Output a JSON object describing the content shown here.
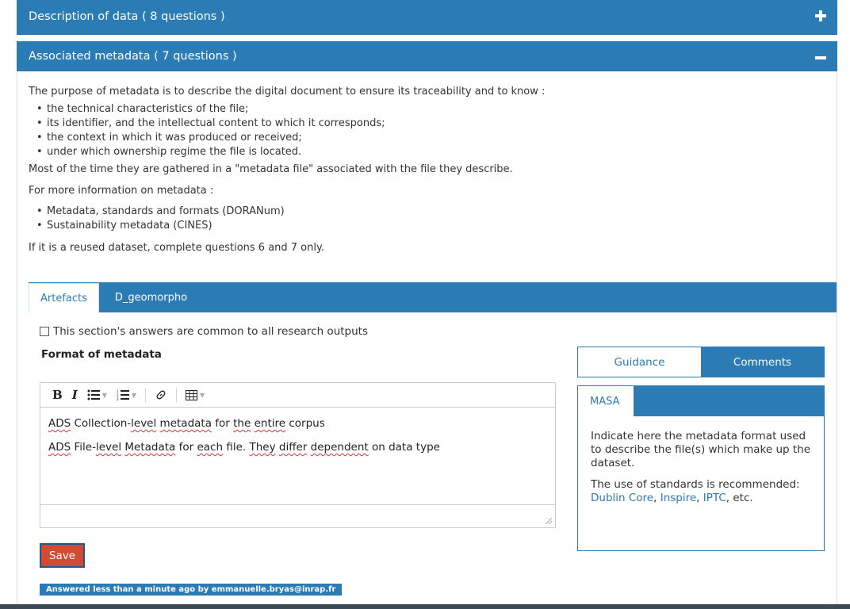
{
  "panels": {
    "description": {
      "title": "Description of data ( 8 questions )",
      "toggle": "+"
    },
    "metadata": {
      "title": "Associated metadata ( 7 questions )",
      "toggle": "−"
    }
  },
  "intro": {
    "p1": "The purpose of metadata is to describe the digital document to ensure its traceability and to know :",
    "list1": [
      "the technical characteristics of the file;",
      "its identifier, and the intellectual content to which it corresponds;",
      "the context in which it was produced or received;",
      "under which ownership regime the file is located."
    ],
    "p2": "Most of the time they are gathered in a \"metadata file\" associated with the file they describe.",
    "p3": "For more information on metadata :",
    "list2": [
      "Metadata, standards and formats (DORANum)",
      "Sustainability metadata (CINES)"
    ],
    "p4": "If it is a reused dataset, complete questions 6 and 7 only."
  },
  "tabs": {
    "active": "Artefacts",
    "second": "D_geomorpho"
  },
  "common_checkbox": "This section's answers are common to all research outputs",
  "question": {
    "title": "Format of metadata"
  },
  "editor": {
    "toolbar": {
      "bold": "B",
      "italic": "I"
    },
    "line1": {
      "a": "ADS",
      "b": " Collection-",
      "c": "level",
      "d": " ",
      "e": "metadata",
      "f": " for ",
      "g": "the",
      "h": " ",
      "i": "entire",
      "j": " corpus"
    },
    "line2": {
      "a": "ADS",
      "b": " File-",
      "c": "level",
      "d": " ",
      "e": "Metadata",
      "f": " for ",
      "g": "each",
      "h": " file. ",
      "i": "They",
      "j": " ",
      "k": "differ",
      "l": " ",
      "m": "dependent",
      "n": " on data type"
    }
  },
  "save_button": "Save",
  "answered_text": "Answered less than a minute ago by emmanuelle.bryas@inrap.fr",
  "guidance": {
    "tab_guidance": "Guidance",
    "tab_comments": "Comments",
    "org": "MASA",
    "text1": "Indicate here the metadata format used to describe the file(s) which make up the dataset.",
    "text2": "The use of standards is recommended:",
    "link1": "Dublin Core",
    "link2": "Inspire",
    "link3": "IPTC",
    "sep": ", ",
    "etc": ", etc."
  },
  "colors": {
    "primary": "#2b7bb5",
    "save": "#d14b33",
    "bottom": "#3c4a55"
  }
}
